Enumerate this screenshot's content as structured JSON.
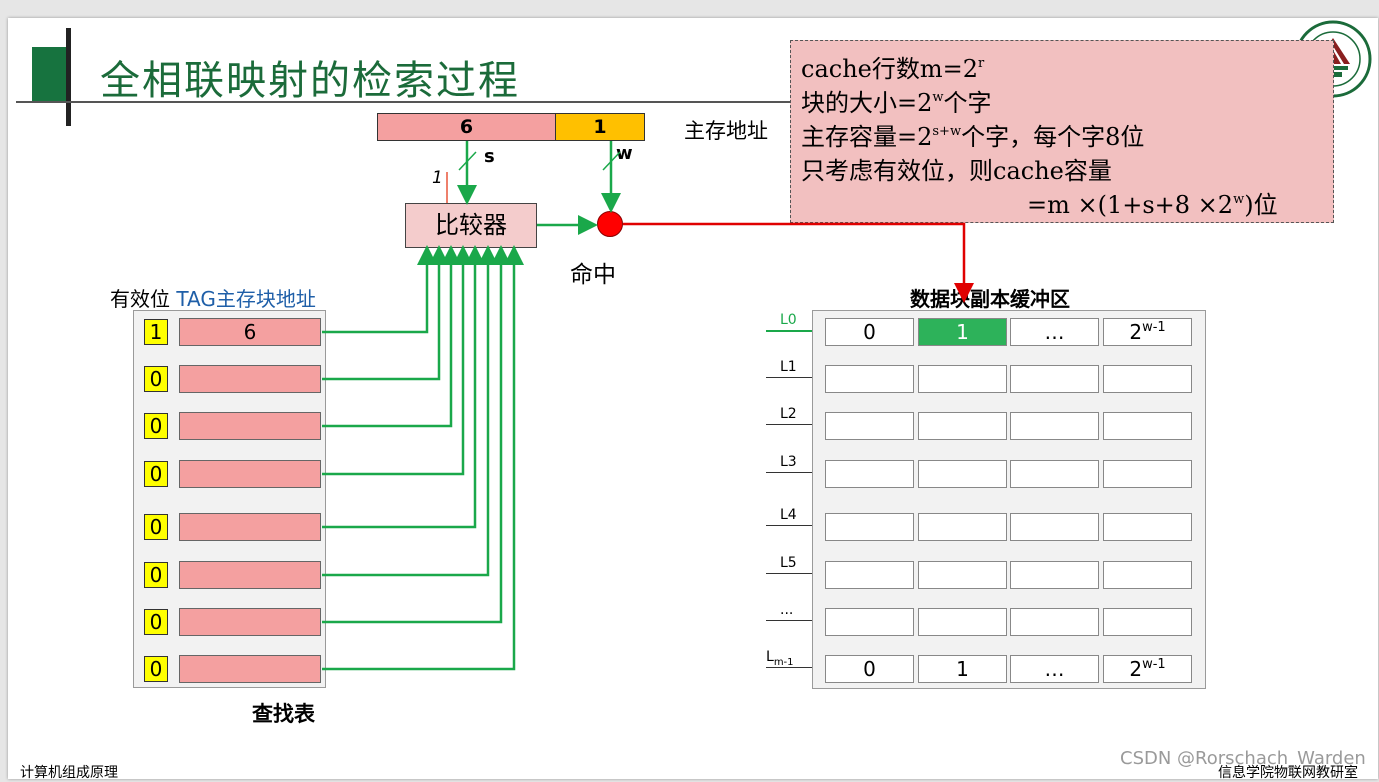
{
  "slide": {
    "title": "全相联映射的检索过程",
    "footer_left": "计算机组成原理",
    "footer_right": "信息学院物联网教研室",
    "watermark": "CSDN @Rorschach_Warden"
  },
  "info_box": {
    "line1_text": "cache行数m=2",
    "line1_sup": "r",
    "line2_text_a": "块的大小=2",
    "line2_sup": "w",
    "line2_text_b": "个字",
    "line3_text_a": "主存容量=2",
    "line3_sup": "s+w",
    "line3_text_b": "个字，每个字8位",
    "line4_text": "只考虑有效位，则cache容量",
    "line5_text_a": "=m ×(1+s+8 ×2",
    "line5_sup": "w",
    "line5_text_b": ")位"
  },
  "address": {
    "tag_value": "6",
    "word_value": "1",
    "label": "主存地址",
    "s_label": "s",
    "w_label": "w",
    "valid_in_label": "1"
  },
  "comparator": {
    "label": "比较器"
  },
  "hit": {
    "label": "命中"
  },
  "lookup_table": {
    "header": "有效位 ",
    "header_tag": "TAG主存块地址",
    "caption": "查找表",
    "rows": [
      {
        "valid": "1",
        "tag": "6"
      },
      {
        "valid": "0",
        "tag": ""
      },
      {
        "valid": "0",
        "tag": ""
      },
      {
        "valid": "0",
        "tag": ""
      },
      {
        "valid": "0",
        "tag": ""
      },
      {
        "valid": "0",
        "tag": ""
      },
      {
        "valid": "0",
        "tag": ""
      },
      {
        "valid": "0",
        "tag": ""
      }
    ]
  },
  "data_buffer": {
    "title": "数据块副本缓冲区",
    "line_labels": [
      "L0",
      "L1",
      "L2",
      "L3",
      "L4",
      "L5",
      "...",
      "L"
    ],
    "last_line_sub": "m-1",
    "first_row": [
      "0",
      "1",
      "…",
      "2"
    ],
    "last_row": [
      "0",
      "1",
      "…",
      "2"
    ],
    "last_cell_sup": "w-1",
    "hit_cell": "1"
  },
  "colors": {
    "title_green": "#1b6b3a",
    "wire_green": "#1aa84a",
    "hit_red": "#ff0000",
    "tag_pink": "#f4a0a0",
    "word_gold": "#ffc000",
    "valid_yellow": "#ffff00",
    "hit_cell_green": "#2db25a"
  }
}
